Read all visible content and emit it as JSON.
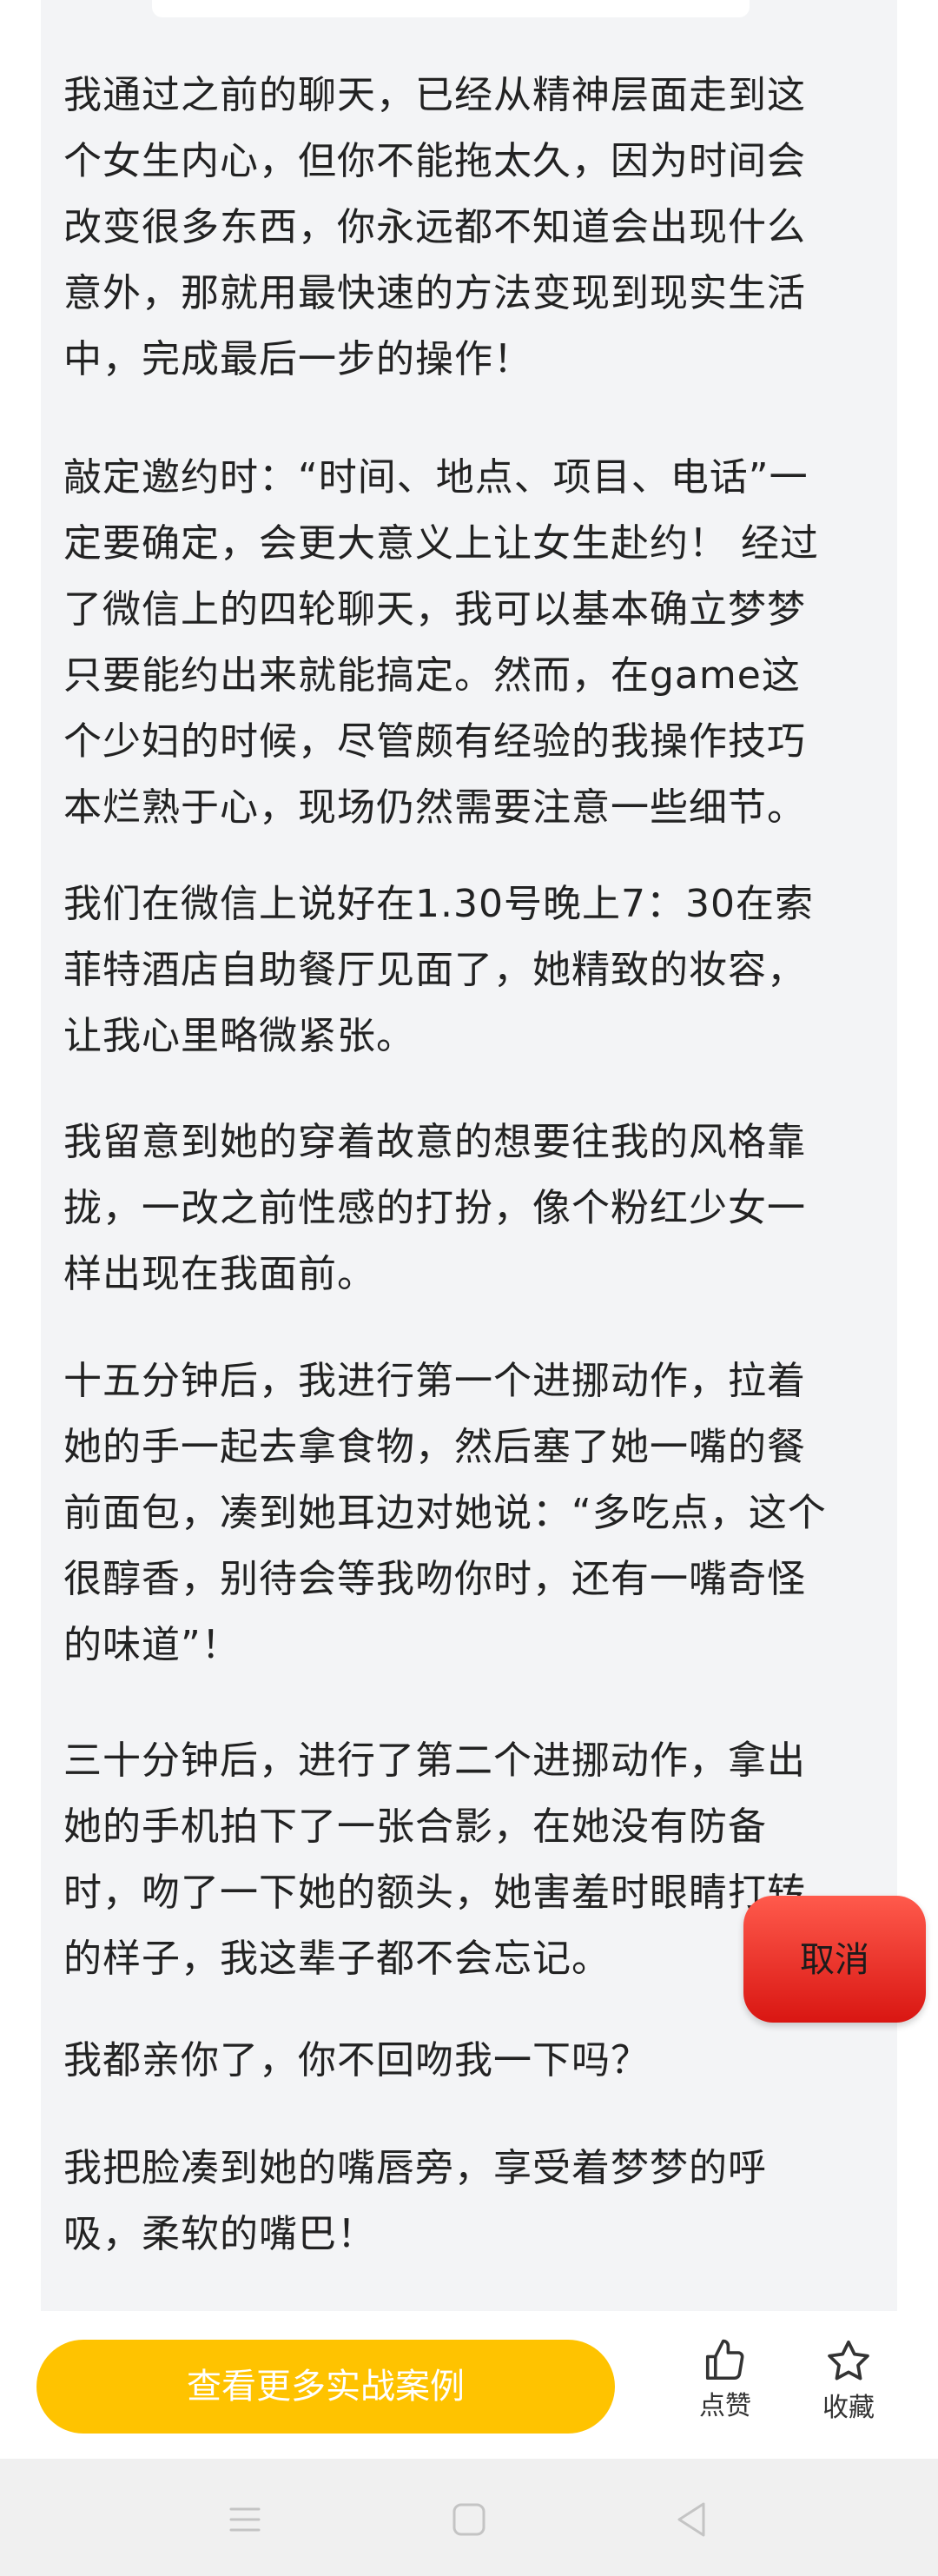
{
  "article": {
    "paragraphs": [
      "我通过之前的聊天，已经从精神层面走到这\n个女生内心，但你不能拖太久，因为时间会\n改变很多东西，你永远都不知道会出现什么\n意外，那就用最快速的方法变现到现实生活\n中，完成最后一步的操作！",
      "敲定邀约时：“时间、地点、项目、电话”一\n定要确定，会更大意义上让女生赴约！ 经过\n了微信上的四轮聊天，我可以基本确立梦梦\n只要能约出来就能搞定。然而，在game这\n个少妇的时候，尽管颇有经验的我操作技巧\n本烂熟于心，现场仍然需要注意一些细节。",
      "我们在微信上说好在1.30号晚上7：30在索\n菲特酒店自助餐厅见面了，她精致的妆容，\n让我心里略微紧张。",
      "我留意到她的穿着故意的想要往我的风格靠\n拢，一改之前性感的打扮，像个粉红少女一\n样出现在我面前。",
      "十五分钟后，我进行第一个进挪动作，拉着\n她的手一起去拿食物，然后塞了她一嘴的餐\n前面包，凑到她耳边对她说：“多吃点，这个\n很醇香，别待会等我吻你时，还有一嘴奇怪\n的味道”！",
      "三十分钟后，进行了第二个进挪动作，拿出\n她的手机拍下了一张合影，在她没有防备\n时，吻了一下她的额头，她害羞时眼睛打转\n的样子，我这辈子都不会忘记。",
      "我都亲你了，你不回吻我一下吗？",
      "我把脸凑到她的嘴唇旁，享受着梦梦的呼\n吸，柔软的嘴巴！"
    ]
  },
  "floating": {
    "cancel_label": "取消",
    "color": "#e8261f"
  },
  "bottom_bar": {
    "more_cases_label": "查看更多实战案例",
    "like_label": "点赞",
    "favorite_label": "收藏",
    "accent": "#ffc300"
  },
  "icons": {
    "like": "thumbs-up-icon",
    "favorite": "star-icon",
    "nav_menu": "menu-icon",
    "nav_home": "home-square-icon",
    "nav_back": "back-triangle-icon"
  }
}
